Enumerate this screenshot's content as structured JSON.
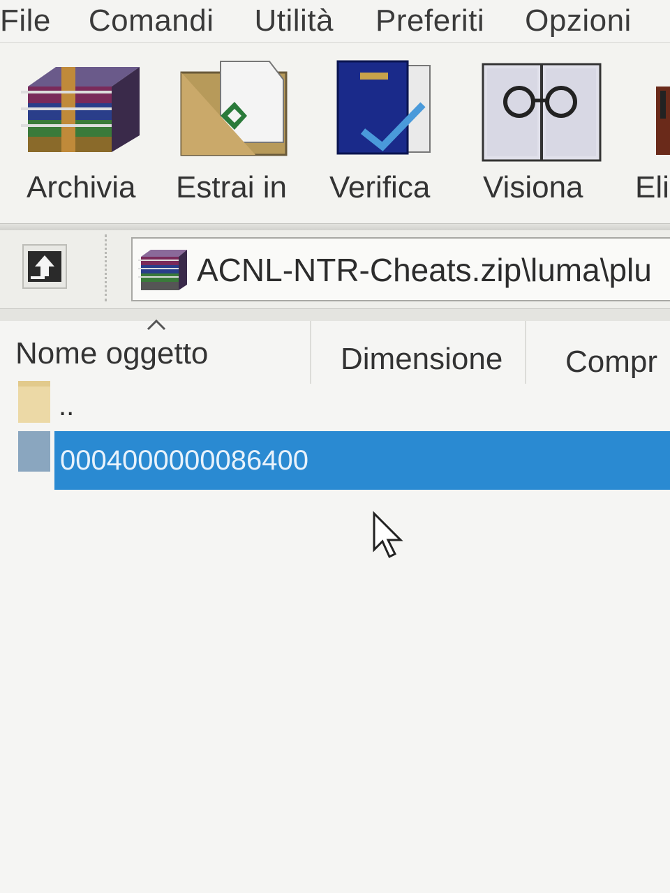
{
  "menubar": {
    "items": [
      "File",
      "Comandi",
      "Utilità",
      "Preferiti",
      "Opzioni"
    ]
  },
  "toolbar": {
    "buttons": [
      {
        "label": "Archivia",
        "icon": "winrar-archive-icon"
      },
      {
        "label": "Estrai in",
        "icon": "extract-folder-icon"
      },
      {
        "label": "Verifica",
        "icon": "test-checkmark-icon"
      },
      {
        "label": "Visiona",
        "icon": "view-glasses-book-icon"
      },
      {
        "label": "Eli",
        "icon": "delete-icon"
      }
    ]
  },
  "address": {
    "path": "ACNL-NTR-Cheats.zip\\luma\\plu"
  },
  "list": {
    "columns": [
      "Nome oggetto",
      "Dimensione",
      "Compr"
    ],
    "rows": [
      {
        "name": "..",
        "type": "parent-folder"
      },
      {
        "name": "0004000000086400",
        "type": "folder",
        "selected": true
      }
    ]
  },
  "colors": {
    "selection": "#2a8ad2",
    "background": "#f5f5f3"
  }
}
